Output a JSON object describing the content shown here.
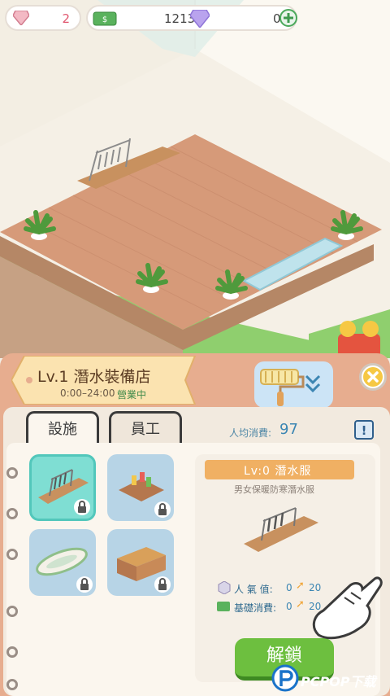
{
  "resources": {
    "gems": "2",
    "cash": "1213",
    "diamonds": "0",
    "add_icon": "plus-icon"
  },
  "shop": {
    "title": "Lv.1 潛水裝備店",
    "hours": "0:00–24:00",
    "status": "營業中"
  },
  "tabs": [
    {
      "label": "設施"
    },
    {
      "label": "員工"
    }
  ],
  "avg_spend": {
    "label": "人均消費:",
    "value": "97"
  },
  "info_button": "!",
  "facility": {
    "level_label": "Lv:0 潛水服",
    "description": "男女保暖防寒潛水服",
    "stats": [
      {
        "label": "人 氣 值:",
        "value": "0",
        "next": "20"
      },
      {
        "label": "基礎消費:",
        "value": "0",
        "next": "20"
      }
    ],
    "unlock_label": "解鎖"
  },
  "watermark": "PCPOP下载",
  "colors": {
    "panel": "#e7ad8f",
    "accent_blue": "#3c86b3",
    "unlock_green": "#6dbf3f",
    "banner_orange": "#f0b063"
  }
}
